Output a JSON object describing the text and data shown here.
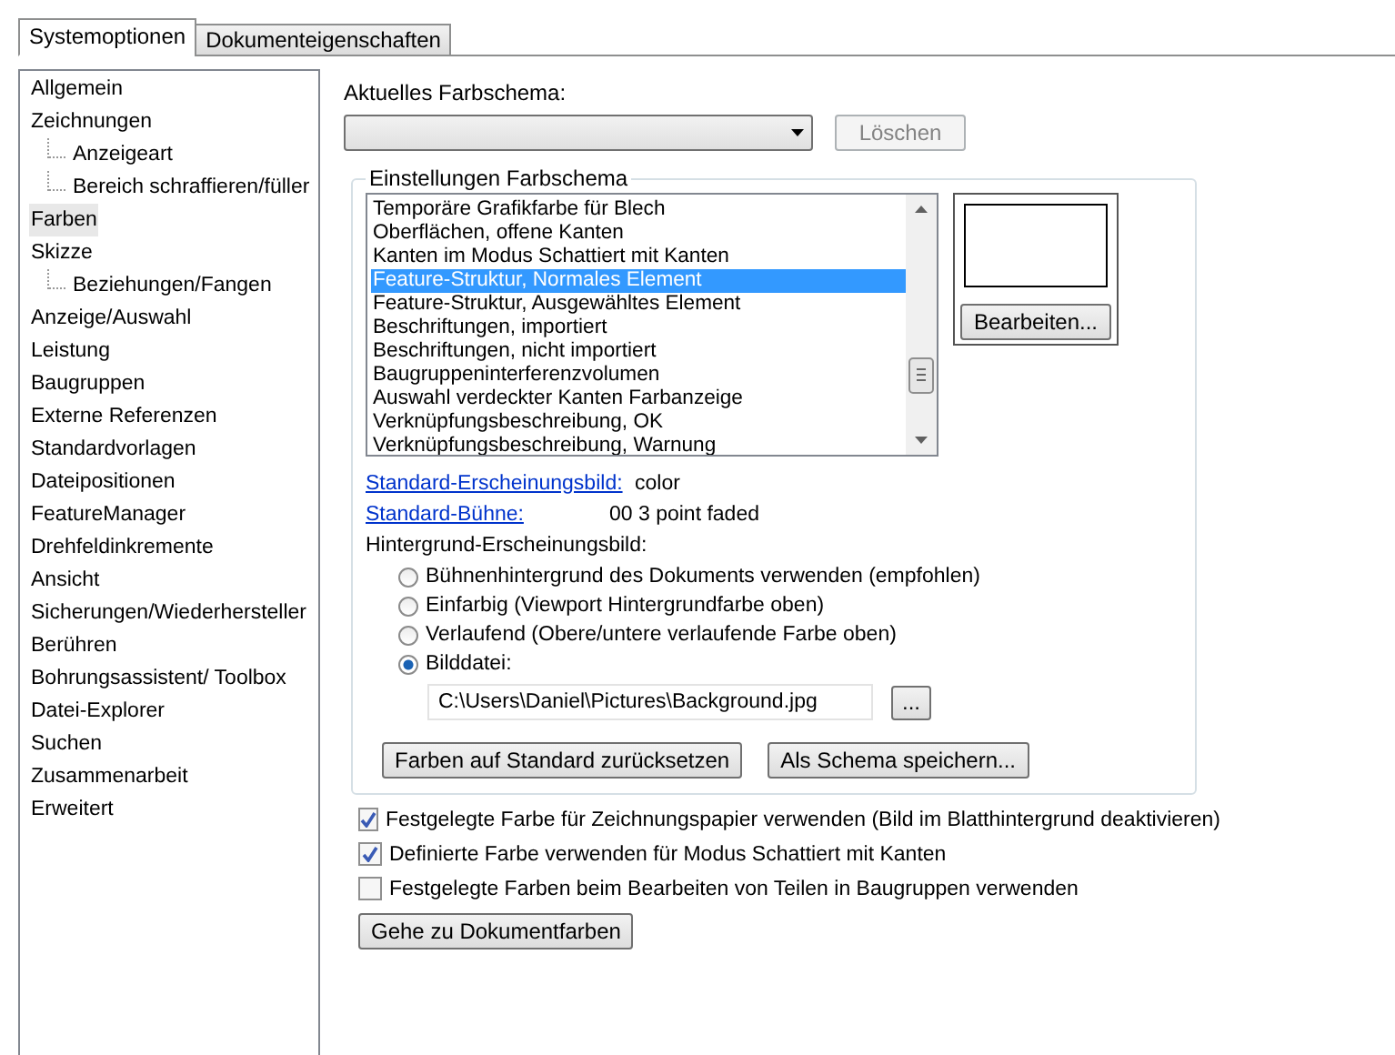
{
  "tabs": [
    {
      "label": "Systemoptionen",
      "selected": true
    },
    {
      "label": "Dokumenteigenschaften",
      "selected": false
    }
  ],
  "sidebar": {
    "items": [
      {
        "label": "Allgemein",
        "selected": false
      },
      {
        "label": "Zeichnungen",
        "selected": false,
        "children": [
          {
            "label": "Anzeigeart",
            "selected": false
          },
          {
            "label": "Bereich schraffieren/füller",
            "selected": false
          }
        ]
      },
      {
        "label": "Farben",
        "selected": true
      },
      {
        "label": "Skizze",
        "selected": false,
        "children": [
          {
            "label": "Beziehungen/Fangen",
            "selected": false
          }
        ]
      },
      {
        "label": "Anzeige/Auswahl",
        "selected": false
      },
      {
        "label": "Leistung",
        "selected": false
      },
      {
        "label": "Baugruppen",
        "selected": false
      },
      {
        "label": "Externe Referenzen",
        "selected": false
      },
      {
        "label": "Standardvorlagen",
        "selected": false
      },
      {
        "label": "Dateipositionen",
        "selected": false
      },
      {
        "label": "FeatureManager",
        "selected": false
      },
      {
        "label": "Drehfeldinkremente",
        "selected": false
      },
      {
        "label": "Ansicht",
        "selected": false
      },
      {
        "label": "Sicherungen/Wiederhersteller",
        "selected": false
      },
      {
        "label": "Berühren",
        "selected": false
      },
      {
        "label": "Bohrungsassistent/ Toolbox",
        "selected": false
      },
      {
        "label": "Datei-Explorer",
        "selected": false
      },
      {
        "label": "Suchen",
        "selected": false
      },
      {
        "label": "Zusammenarbeit",
        "selected": false
      },
      {
        "label": "Erweitert",
        "selected": false
      }
    ]
  },
  "scheme": {
    "label": "Aktuelles Farbschema:",
    "delete_button": {
      "label": "Löschen",
      "disabled": true
    }
  },
  "settings_group": {
    "title": "Einstellungen Farbschema",
    "items": [
      {
        "label": "Temporäre Grafikfarbe für Blech",
        "selected": false
      },
      {
        "label": "Oberflächen, offene Kanten",
        "selected": false
      },
      {
        "label": "Kanten im Modus Schattiert mit Kanten",
        "selected": false
      },
      {
        "label": "Feature-Struktur, Normales Element",
        "selected": true
      },
      {
        "label": "Feature-Struktur, Ausgewähltes Element",
        "selected": false
      },
      {
        "label": "Beschriftungen, importiert",
        "selected": false
      },
      {
        "label": "Beschriftungen, nicht importiert",
        "selected": false
      },
      {
        "label": "Baugruppeninterferenzvolumen",
        "selected": false
      },
      {
        "label": "Auswahl verdeckter Kanten Farbanzeige",
        "selected": false
      },
      {
        "label": "Verknüpfungsbeschreibung, OK",
        "selected": false
      },
      {
        "label": "Verknüpfungsbeschreibung, Warnung",
        "selected": false
      }
    ],
    "edit_button": "Bearbeiten...",
    "links": [
      {
        "label": "Standard-Erscheinungsbild:",
        "value": "color"
      },
      {
        "label": "Standard-Bühne:",
        "value": "00 3 point faded"
      }
    ],
    "background_label": "Hintergrund-Erscheinungsbild:",
    "radios": [
      {
        "label": "Bühnenhintergrund des Dokuments verwenden (empfohlen)",
        "selected": false
      },
      {
        "label": "Einfarbig (Viewport Hintergrundfarbe oben)",
        "selected": false
      },
      {
        "label": "Verlaufend (Obere/untere verlaufende Farbe oben)",
        "selected": false
      },
      {
        "label": "Bilddatei:",
        "selected": true
      }
    ],
    "image_path": "C:\\Users\\Daniel\\Pictures\\Background.jpg",
    "browse_button": "...",
    "buttons": [
      "Farben auf Standard zurücksetzen",
      "Als Schema speichern..."
    ]
  },
  "checkboxes": [
    {
      "label": "Festgelegte Farbe für Zeichnungspapier verwenden (Bild im Blatthintergrund deaktivieren)",
      "checked": true
    },
    {
      "label": "Definierte Farbe verwenden für Modus Schattiert mit Kanten",
      "checked": true
    },
    {
      "label": "Festgelegte Farben beim Bearbeiten von Teilen in Baugruppen verwenden",
      "checked": false
    }
  ],
  "document_colors_button": "Gehe zu Dokumentfarben"
}
